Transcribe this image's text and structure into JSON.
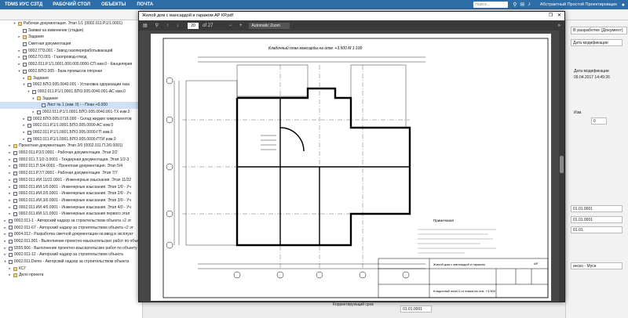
{
  "topbar": {
    "brand": "TDMS ИУС СЗТД",
    "menu": [
      "РАБОЧИЙ СТОЛ",
      "ОБЪЕКТЫ",
      "ПОЧТА"
    ],
    "search_placeholder": "Найти...",
    "user": "Абстрактный Простой Проектировщик"
  },
  "tree": {
    "rows": [
      {
        "indent": 2,
        "exp": "▾",
        "folder": true,
        "label": "Рабочая документация. Этап 1/1 (0002.011.Р.1/1.0001)"
      },
      {
        "indent": 3,
        "exp": "",
        "folder": false,
        "label": "Заявки на изменение (стадия)"
      },
      {
        "indent": 3,
        "exp": "▸",
        "folder": true,
        "label": "Задания"
      },
      {
        "indent": 3,
        "exp": "",
        "folder": false,
        "label": "Сметная документация"
      },
      {
        "indent": 3,
        "exp": "▸",
        "folder": false,
        "label": "0002.ГП3.001 - Завод газопереработывающий"
      },
      {
        "indent": 3,
        "exp": "▸",
        "folder": false,
        "label": "0002.ГО.001 - Газопровод-отвод"
      },
      {
        "indent": 3,
        "exp": "▸",
        "folder": false,
        "label": "0002.011.Р.1/1.0001.000.000.0000-СП изм.0 - Канцелярия"
      },
      {
        "indent": 3,
        "exp": "▾",
        "folder": false,
        "label": "0002.БПО.005 - База промысла опорная"
      },
      {
        "indent": 4,
        "exp": "▸",
        "folder": true,
        "label": "Задания"
      },
      {
        "indent": 4,
        "exp": "▾",
        "folder": false,
        "label": "0002.БПО.005.0040.001 - Установка одоризации газа"
      },
      {
        "indent": 5,
        "exp": "▾",
        "folder": false,
        "label": "0002.011.Р.1/1.0001.БПО.005.0040.001-АС изм.0"
      },
      {
        "indent": 6,
        "exp": "▾",
        "folder": true,
        "label": "Задания"
      },
      {
        "indent": 7,
        "exp": "",
        "folder": false,
        "label": "Лист № 1 (изм. 0) - - План +0.000",
        "sel": true
      },
      {
        "indent": 6,
        "exp": "▸",
        "folder": false,
        "label": "0002.011.Р.1/1.0001.БПО.005.0040.001-ТХ изм.0"
      },
      {
        "indent": 4,
        "exp": "▸",
        "folder": false,
        "label": "0002.БПО.005.0716.000 - Склад жидких химреагентов"
      },
      {
        "indent": 4,
        "exp": "▸",
        "folder": false,
        "label": "0002.011.Р.1/1.0001.БПО.005.0000-АС изм.0"
      },
      {
        "indent": 4,
        "exp": "▸",
        "folder": false,
        "label": "0002.011.Р.1/1.0001.БПО.005.0000-ГП изм.0"
      },
      {
        "indent": 4,
        "exp": "▸",
        "folder": false,
        "label": "0002.011.Р.1/1.0001.БПО.005.0000-ПТИ изм.0"
      },
      {
        "indent": 1,
        "exp": "▸",
        "folder": true,
        "label": "Проектная документация. Этап 2/0 (0002.011.П.2/0.0001)"
      },
      {
        "indent": 1,
        "exp": "▸",
        "folder": false,
        "label": "0002.011.Р.2/2.0001 - Рабочая документация. Этап 2/2"
      },
      {
        "indent": 1,
        "exp": "▸",
        "folder": false,
        "label": "0002.011.Т.1/2-3.0001 - Тендерная документация. Этап 1/2-3"
      },
      {
        "indent": 1,
        "exp": "▸",
        "folder": false,
        "label": "0002.011.П.5/4.0001 - Проектная документация. Этап 5/4"
      },
      {
        "indent": 1,
        "exp": "▸",
        "folder": false,
        "label": "0002.011.Р.7/7.0001 - Рабочая документация. Этап 7/7"
      },
      {
        "indent": 1,
        "exp": "▸",
        "folder": false,
        "label": "0002.011.ИИ.11/22.0001 - Инженерные изыскания. Этап 11/22"
      },
      {
        "indent": 1,
        "exp": "▸",
        "folder": false,
        "label": "0002.011.ИИ.1/0.0001 - Инженерные изыскания. Этап 1/0 - Уч"
      },
      {
        "indent": 1,
        "exp": "▸",
        "folder": false,
        "label": "0002.011.ИИ.2/0.0001 - Инженерные изыскания. Этап 2/0 - Уч"
      },
      {
        "indent": 1,
        "exp": "▸",
        "folder": false,
        "label": "0002.011.ИИ.3/0.0001 - Инженерные изыскания. Этап 3/0 - Уч"
      },
      {
        "indent": 1,
        "exp": "▸",
        "folder": false,
        "label": "0002.011.ИИ.4/0.0001 - Инженерные изыскания. Этап 4/0 - Уч"
      },
      {
        "indent": 1,
        "exp": "▸",
        "folder": false,
        "label": "0002.011.ИИ.1/1.0001 - Инженерные изыскания первого этап"
      },
      {
        "indent": 0,
        "exp": "▸",
        "folder": false,
        "label": "0002.011-1 - Авторский надзор за строительством объекта «2 эт"
      },
      {
        "indent": 0,
        "exp": "▸",
        "folder": false,
        "label": "0002.011-67 - Авторский надзор за строительством объекта «2 эт"
      },
      {
        "indent": 0,
        "exp": "▸",
        "folder": false,
        "label": "0004.012 - Разработка сметной документации на ввод в эксплуат"
      },
      {
        "indent": 0,
        "exp": "▸",
        "folder": false,
        "label": "0002.011.901 - Выполнение проектно-изыскательских работ по объекту"
      },
      {
        "indent": 0,
        "exp": "▸",
        "folder": false,
        "label": "5555.666 - Выполнение проектно-изыскательских работ по объекту"
      },
      {
        "indent": 0,
        "exp": "▸",
        "folder": false,
        "label": "0002.011-12 - Авторский надзор за строительством объекта"
      },
      {
        "indent": 0,
        "exp": "▾",
        "folder": false,
        "label": "0002.011.Demo - Авторский надзор за строительством объекта"
      },
      {
        "indent": 1,
        "exp": "▸",
        "folder": true,
        "label": "КСГ"
      },
      {
        "indent": 1,
        "exp": "▸",
        "folder": true,
        "label": "Дело проекта"
      }
    ]
  },
  "modal": {
    "title": "Жилой дом с мансардой и гаражом АР КР.pdf",
    "page_current": "20",
    "page_total": "of 27",
    "zoom": "Automatic Zoom",
    "drawing_title": "Кладочный план мансарды на отм. +3.500  М 1:100",
    "notes_title": "Примечания",
    "stamp_line1": "Жилой дом с мансардой и гаражом",
    "stamp_line2": "Кладочный план 2-го этажа на отм. +3.500",
    "stamp_code": "АР"
  },
  "right_panel": {
    "status": "В разработке (Документ)",
    "date_mod_label": "Дата модификации",
    "date_mod_label2": "Дата модификации",
    "date_mod_value": "09.04.2017 14:49:26",
    "rev_label": "Изм.",
    "rev_value": "0",
    "date1": "01.01.0001",
    "date2": "01.01.0001",
    "date3": "01.01.",
    "author": "инско - Муси"
  },
  "bottom": {
    "label": "Корректирующий срок",
    "value": "01.01.0001"
  }
}
